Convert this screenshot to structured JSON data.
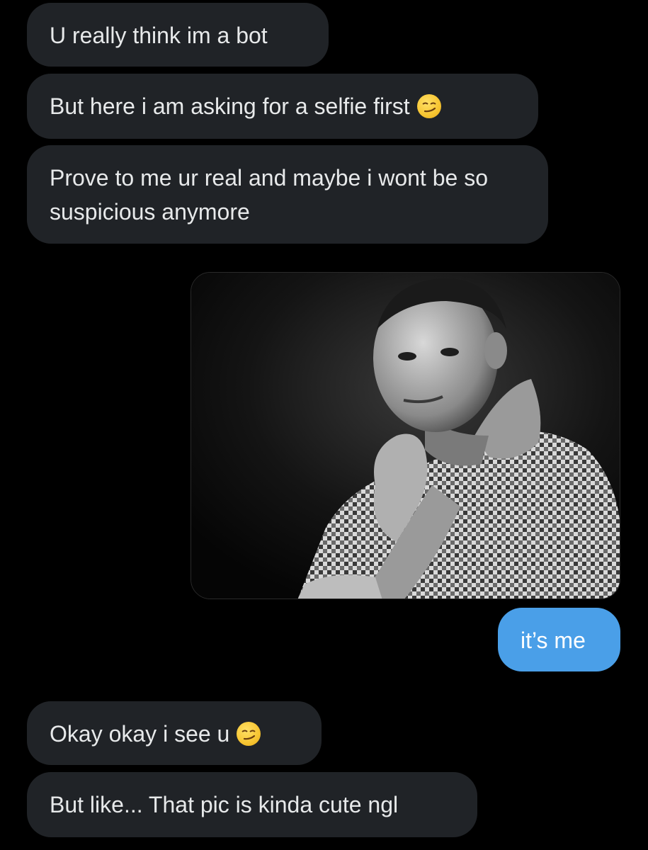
{
  "messages": {
    "m1": "U really think im a bot",
    "m2": "But here i am asking for a selfie first",
    "m3": "Prove to me ur real and maybe i wont be so suspicious anymore",
    "m4": "it’s me",
    "m5": "Okay okay i see u",
    "m6": "But like... That pic is kinda cute ngl"
  },
  "emoji": "smirking-face-icon",
  "colors": {
    "incoming_bubble": "#202327",
    "outgoing_bubble": "#4a9fe8",
    "background": "#000000"
  }
}
